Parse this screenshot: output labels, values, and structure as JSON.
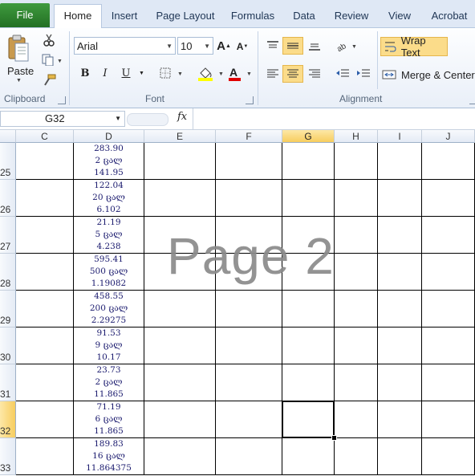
{
  "tabs": {
    "file": "File",
    "items": [
      "Home",
      "Insert",
      "Page Layout",
      "Formulas",
      "Data",
      "Review",
      "View",
      "Acrobat"
    ],
    "active": "Home"
  },
  "ribbon": {
    "clipboard": {
      "paste": "Paste",
      "label": "Clipboard"
    },
    "font": {
      "name": "Arial",
      "size": "10",
      "label": "Font",
      "bold": "B",
      "italic": "I",
      "underline": "U",
      "font_color_letter": "A"
    },
    "alignment": {
      "wrap_text": "Wrap Text",
      "merge_center": "Merge & Center",
      "label": "Alignment"
    }
  },
  "formula_bar": {
    "name_box": "G32",
    "fx": "fx",
    "content": ""
  },
  "grid": {
    "columns": [
      "C",
      "D",
      "E",
      "F",
      "G",
      "H",
      "I",
      "J"
    ],
    "selected_column": "G",
    "rows": [
      {
        "num": "25",
        "d": [
          "283.90",
          "2 ცალ",
          "141.95"
        ]
      },
      {
        "num": "26",
        "d": [
          "122.04",
          "20 ცალ",
          "6.102"
        ]
      },
      {
        "num": "27",
        "d": [
          "21.19",
          "5 ცალ",
          "4.238"
        ]
      },
      {
        "num": "28",
        "d": [
          "595.41",
          "500 ცალ",
          "1.19082"
        ]
      },
      {
        "num": "29",
        "d": [
          "458.55",
          "200 ცალ",
          "2.29275"
        ]
      },
      {
        "num": "30",
        "d": [
          "91.53",
          "9 ცალ",
          "10.17"
        ]
      },
      {
        "num": "31",
        "d": [
          "23.73",
          "2 ცალ",
          "11.865"
        ]
      },
      {
        "num": "32",
        "d": [
          "71.19",
          "6 ცალ",
          "11.865"
        ]
      },
      {
        "num": "33",
        "d": [
          "189.83",
          "16 ცალ",
          "11.864375"
        ]
      }
    ],
    "selected_row": "32",
    "watermark": "Page 2"
  },
  "colors": {
    "file_tab": "#2d7b2d",
    "highlight": "#fbdc8a",
    "font_color": "#e00000",
    "fill_color": "#ffff00"
  }
}
